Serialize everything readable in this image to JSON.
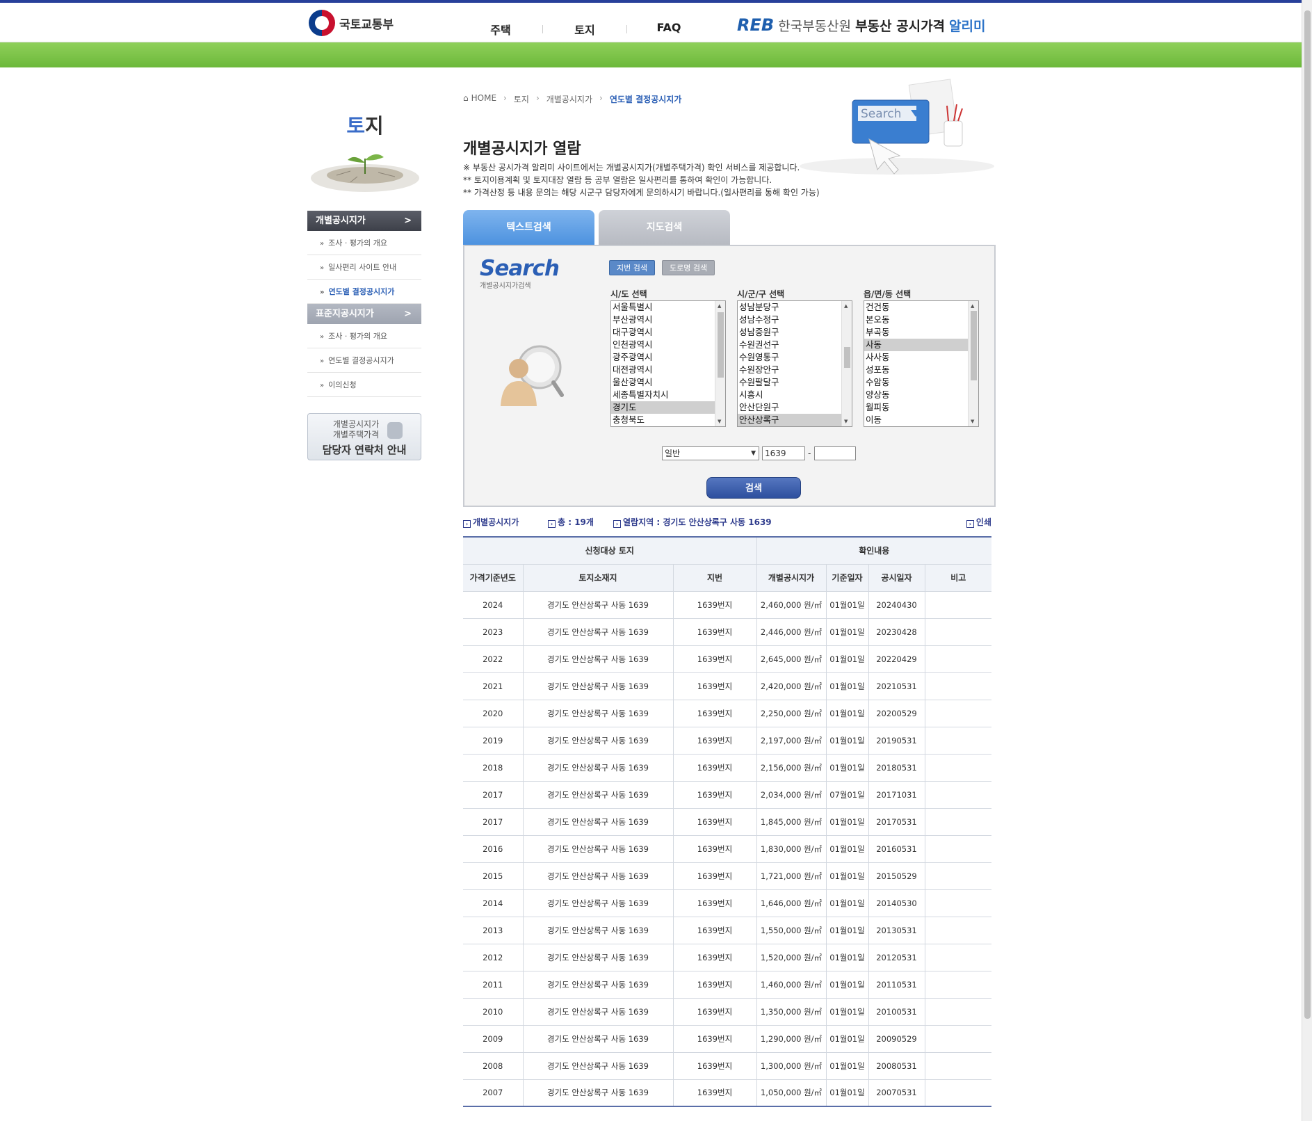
{
  "header": {
    "ministry": "국토교통부",
    "nav": [
      "주택",
      "토지",
      "FAQ"
    ],
    "reb_mark": "REB",
    "agency": "한국부동산원",
    "service": "부동산 공시가격",
    "service_suffix": "알리미"
  },
  "sidebar": {
    "title_first": "토",
    "title_rest": "지",
    "group1": {
      "label": "개별공시지가",
      "items": [
        "조사 · 평가의 개요",
        "일사편리 사이트 안내",
        "연도별 결정공시지가"
      ]
    },
    "group2": {
      "label": "표준지공시지가",
      "items": [
        "조사 · 평가의 개요",
        "연도별 결정공시지가",
        "이의신청"
      ]
    },
    "banner": {
      "line1": "개별공시지가",
      "line2": "개별주택가격",
      "line3": "담당자 연락처 안내"
    }
  },
  "breadcrumb": [
    "HOME",
    "토지",
    "개별공시지가",
    "연도별 결정공시지가"
  ],
  "hero_search_text": "Search",
  "page_title": "개별공시지가 열람",
  "notices": [
    "※ 부동산 공시가격 알리미 사이트에서는 개별공시지가(개별주택가격) 확인 서비스를 제공합니다.",
    "** 토지이용계획 및 토지대장 열람 등 공부 열람은 일사편리를 통하여 확인이 가능합니다.",
    "** 가격산정 등 내용 문의는 해당 시군구 담당자에게 문의하시기 바랍니다.(일사편리를 통해 확인 가능)"
  ],
  "tabs": [
    "텍스트검색",
    "지도검색"
  ],
  "search": {
    "logo_big": "Search",
    "logo_small": "개별공시지가검색",
    "btn_jibun": "지번 검색",
    "btn_road": "도로명 검색",
    "label_sido": "시/도 선택",
    "label_sigungu": "시/군/구 선택",
    "label_dong": "읍/면/동 선택",
    "sido_options": [
      "서울특별시",
      "부산광역시",
      "대구광역시",
      "인천광역시",
      "광주광역시",
      "대전광역시",
      "울산광역시",
      "세종특별자치시",
      "경기도",
      "충청북도"
    ],
    "sigungu_options": [
      "성남분당구",
      "성남수정구",
      "성남중원구",
      "수원권선구",
      "수원영통구",
      "수원장안구",
      "수원팔달구",
      "시흥시",
      "안산단원구",
      "안산상록구"
    ],
    "dong_options": [
      "건건동",
      "본오동",
      "부곡동",
      "사동",
      "사사동",
      "성포동",
      "수암동",
      "양상동",
      "월피동",
      "이동"
    ],
    "lot_type": "일반",
    "bonbun": "1639",
    "bubun": "",
    "dash": "-",
    "submit": "검색"
  },
  "result_info": {
    "label": "개별공시지가",
    "total": "총 : 19개",
    "region_label": "열람지역 :",
    "region": "경기도 안산상록구 사동 1639",
    "print": "인쇄"
  },
  "table": {
    "group_headers": [
      "신청대상 토지",
      "확인내용"
    ],
    "headers": [
      "가격기준년도",
      "토지소재지",
      "지번",
      "개별공시지가",
      "기준일자",
      "공시일자",
      "비고"
    ],
    "rows": [
      [
        "2024",
        "경기도 안산상록구 사동 1639",
        "1639번지",
        "2,460,000 원/㎡",
        "01월01일",
        "20240430",
        ""
      ],
      [
        "2023",
        "경기도 안산상록구 사동 1639",
        "1639번지",
        "2,446,000 원/㎡",
        "01월01일",
        "20230428",
        ""
      ],
      [
        "2022",
        "경기도 안산상록구 사동 1639",
        "1639번지",
        "2,645,000 원/㎡",
        "01월01일",
        "20220429",
        ""
      ],
      [
        "2021",
        "경기도 안산상록구 사동 1639",
        "1639번지",
        "2,420,000 원/㎡",
        "01월01일",
        "20210531",
        ""
      ],
      [
        "2020",
        "경기도 안산상록구 사동 1639",
        "1639번지",
        "2,250,000 원/㎡",
        "01월01일",
        "20200529",
        ""
      ],
      [
        "2019",
        "경기도 안산상록구 사동 1639",
        "1639번지",
        "2,197,000 원/㎡",
        "01월01일",
        "20190531",
        ""
      ],
      [
        "2018",
        "경기도 안산상록구 사동 1639",
        "1639번지",
        "2,156,000 원/㎡",
        "01월01일",
        "20180531",
        ""
      ],
      [
        "2017",
        "경기도 안산상록구 사동 1639",
        "1639번지",
        "2,034,000 원/㎡",
        "07월01일",
        "20171031",
        ""
      ],
      [
        "2017",
        "경기도 안산상록구 사동 1639",
        "1639번지",
        "1,845,000 원/㎡",
        "01월01일",
        "20170531",
        ""
      ],
      [
        "2016",
        "경기도 안산상록구 사동 1639",
        "1639번지",
        "1,830,000 원/㎡",
        "01월01일",
        "20160531",
        ""
      ],
      [
        "2015",
        "경기도 안산상록구 사동 1639",
        "1639번지",
        "1,721,000 원/㎡",
        "01월01일",
        "20150529",
        ""
      ],
      [
        "2014",
        "경기도 안산상록구 사동 1639",
        "1639번지",
        "1,646,000 원/㎡",
        "01월01일",
        "20140530",
        ""
      ],
      [
        "2013",
        "경기도 안산상록구 사동 1639",
        "1639번지",
        "1,550,000 원/㎡",
        "01월01일",
        "20130531",
        ""
      ],
      [
        "2012",
        "경기도 안산상록구 사동 1639",
        "1639번지",
        "1,520,000 원/㎡",
        "01월01일",
        "20120531",
        ""
      ],
      [
        "2011",
        "경기도 안산상록구 사동 1639",
        "1639번지",
        "1,460,000 원/㎡",
        "01월01일",
        "20110531",
        ""
      ],
      [
        "2010",
        "경기도 안산상록구 사동 1639",
        "1639번지",
        "1,350,000 원/㎡",
        "01월01일",
        "20100531",
        ""
      ],
      [
        "2009",
        "경기도 안산상록구 사동 1639",
        "1639번지",
        "1,290,000 원/㎡",
        "01월01일",
        "20090529",
        ""
      ],
      [
        "2008",
        "경기도 안산상록구 사동 1639",
        "1639번지",
        "1,300,000 원/㎡",
        "01월01일",
        "20080531",
        ""
      ],
      [
        "2007",
        "경기도 안산상록구 사동 1639",
        "1639번지",
        "1,050,000 원/㎡",
        "01월01일",
        "20070531",
        ""
      ]
    ]
  }
}
